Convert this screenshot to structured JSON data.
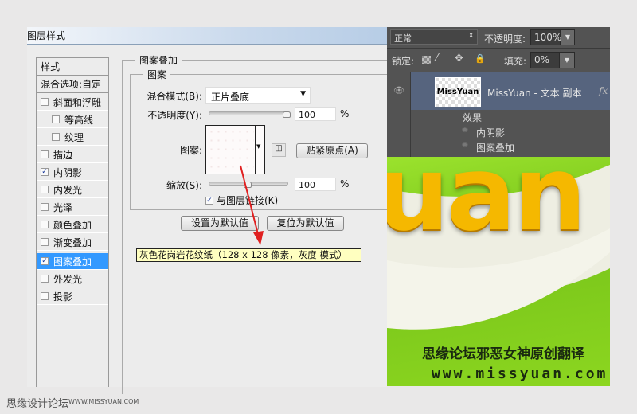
{
  "dialog": {
    "title": "图层样式",
    "styles_header": "样式",
    "blend_options": "混合选项:自定",
    "items": [
      {
        "label": "斜面和浮雕",
        "checked": false
      },
      {
        "label": "等高线",
        "checked": false
      },
      {
        "label": "纹理",
        "checked": false
      },
      {
        "label": "描边",
        "checked": false
      },
      {
        "label": "内阴影",
        "checked": true
      },
      {
        "label": "内发光",
        "checked": false
      },
      {
        "label": "光泽",
        "checked": false
      },
      {
        "label": "颜色叠加",
        "checked": false
      },
      {
        "label": "渐变叠加",
        "checked": false
      },
      {
        "label": "图案叠加",
        "checked": true,
        "selected": true
      },
      {
        "label": "外发光",
        "checked": false
      },
      {
        "label": "投影",
        "checked": false
      }
    ],
    "section_title": "图案叠加",
    "group_title": "图案",
    "blend_mode_label": "混合模式(B):",
    "blend_mode_value": "正片叠底",
    "opacity_label": "不透明度(Y):",
    "opacity_value": "100",
    "percent": "%",
    "pattern_label": "图案:",
    "snap_origin_button": "贴紧原点(A)",
    "scale_label": "缩放(S):",
    "scale_value": "100",
    "link_label": "与图层链接(K)",
    "link_checked": true,
    "set_default_button": "设置为默认值",
    "reset_default_button": "复位为默认值",
    "tooltip": "灰色花岗岩花纹纸（128 x 128 像素，灰度 模式）"
  },
  "layers": {
    "blend_mode": "正常",
    "opacity_label": "不透明度:",
    "opacity_value": "100%",
    "lock_label": "锁定:",
    "fill_label": "填充:",
    "fill_value": "0%",
    "layer_name": "MissYuan - 文本 副本",
    "thumb_text": "MissYuan",
    "fx": "fx",
    "effects_label": "效果",
    "effects": [
      "内阴影",
      "图案叠加"
    ]
  },
  "artwork": {
    "big_text": "uan",
    "caption": "思缘论坛邪恶女神原创翻译",
    "url": "www.missyuan.com"
  },
  "footer": {
    "site": "思缘设计论坛",
    "url": "WWW.MISSYUAN.COM"
  },
  "colors": {
    "selection": "#3399ff",
    "arrow": "#e02020",
    "tooltip_bg": "#ffffc0"
  }
}
